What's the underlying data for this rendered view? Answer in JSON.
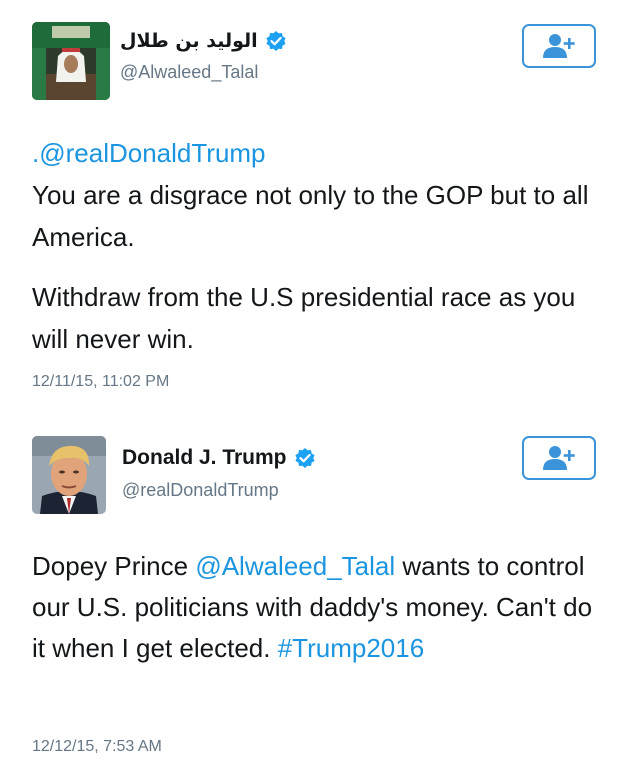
{
  "tweets": [
    {
      "display_name": "الوليد بن طلال",
      "handle": "@Alwaleed_Talal",
      "mention": ".@realDonaldTrump",
      "line1": "You are a disgrace not only to the GOP but to all America.",
      "line2": "Withdraw from the U.S presidential race as you will never win.",
      "timestamp": "12/11/15, 11:02 PM",
      "avatar_icon": "saudi-prince-photo",
      "verified_icon": "verified-badge-icon",
      "follow_icon": "add-user-icon"
    },
    {
      "display_name": "Donald J. Trump",
      "handle": "@realDonaldTrump",
      "text_before": "Dopey Prince ",
      "mention": "@Alwaleed_Talal",
      "text_after": " wants to control our U.S. politicians with daddy's money. Can't do it when I get elected. ",
      "hashtag": "#Trump2016",
      "timestamp": "12/12/15, 7:53 AM",
      "avatar_icon": "trump-portrait-photo",
      "verified_icon": "verified-badge-icon",
      "follow_icon": "add-user-icon"
    }
  ],
  "colors": {
    "link": "#1b95e0",
    "secondary": "#657786",
    "follow_border": "#3b94d9",
    "verified": "#1da1f2"
  }
}
